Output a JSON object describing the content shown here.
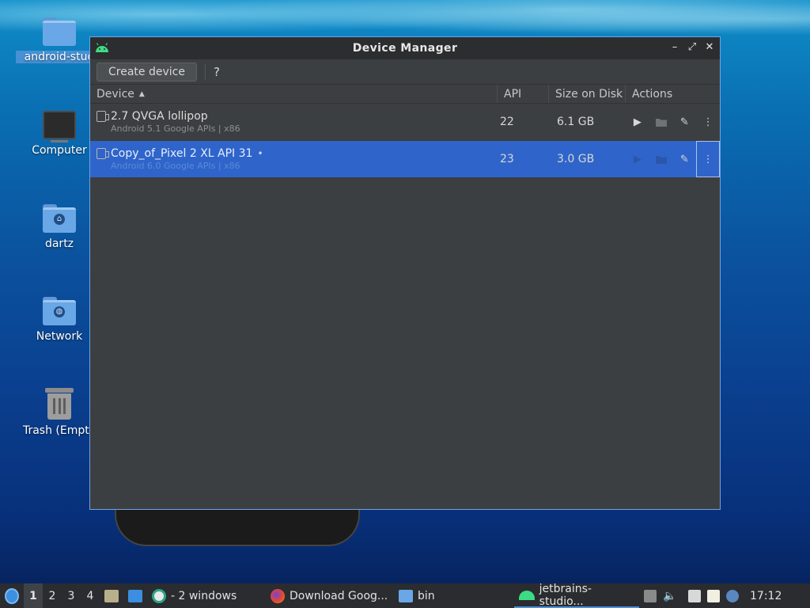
{
  "desktop": {
    "icons": [
      {
        "label": "android-stud",
        "icon": "folder-icon"
      },
      {
        "label": "Computer",
        "icon": "computer-icon"
      },
      {
        "label": "dartz",
        "icon": "home-folder-icon"
      },
      {
        "label": "Network",
        "icon": "network-folder-icon"
      },
      {
        "label": "Trash (Empty",
        "icon": "trash-icon"
      }
    ]
  },
  "window": {
    "title": "Device Manager",
    "controls": {
      "minimize": "–",
      "maximize": "⤢",
      "close": "✕"
    }
  },
  "toolbar": {
    "create_label": "Create device",
    "help_label": "?"
  },
  "table": {
    "columns": [
      "Device",
      "API",
      "Size on Disk",
      "Actions"
    ],
    "sort_indicator": "▲",
    "rows": [
      {
        "name": "2.7  QVGA lollipop",
        "sub": "Android 5.1 Google APIs | x86",
        "api": "22",
        "size": "6.1 GB",
        "selected": false
      },
      {
        "name": "Copy_of_Pixel 2 XL API 31",
        "running_dot": "•",
        "sub": "Android 6.0 Google APIs | x86",
        "api": "23",
        "size": "3.0 GB",
        "selected": true
      }
    ]
  },
  "taskbar": {
    "workspaces": [
      "1",
      "2",
      "3",
      "4"
    ],
    "tasks": [
      {
        "label": "- 2 windows",
        "icon": "app-icon"
      },
      {
        "label": "Download Goog...",
        "icon": "firefox-icon"
      },
      {
        "label": "bin",
        "icon": "folder-icon"
      },
      {
        "label": "jetbrains-studio...",
        "icon": "android-icon"
      }
    ],
    "clock": "17:12"
  },
  "colors": {
    "accent": "#2f65ca",
    "window_bg": "#3c3f41",
    "taskbar_bg": "#2a2c2f"
  }
}
